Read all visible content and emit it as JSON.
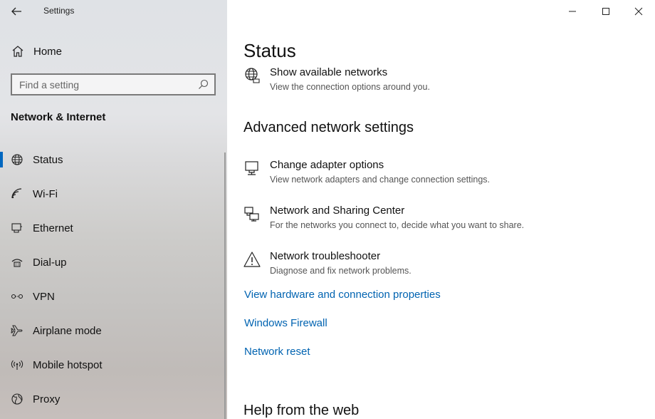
{
  "window": {
    "title": "Settings"
  },
  "sidebar": {
    "home_label": "Home",
    "search_placeholder": "Find a setting",
    "section_title": "Network & Internet",
    "items": [
      {
        "label": "Status",
        "icon": "globe-icon",
        "active": true
      },
      {
        "label": "Wi-Fi",
        "icon": "wifi-icon"
      },
      {
        "label": "Ethernet",
        "icon": "ethernet-icon"
      },
      {
        "label": "Dial-up",
        "icon": "dialup-icon"
      },
      {
        "label": "VPN",
        "icon": "vpn-icon"
      },
      {
        "label": "Airplane mode",
        "icon": "airplane-icon"
      },
      {
        "label": "Mobile hotspot",
        "icon": "hotspot-icon"
      },
      {
        "label": "Proxy",
        "icon": "proxy-icon"
      }
    ]
  },
  "main": {
    "title": "Status",
    "show_networks": {
      "title": "Show available networks",
      "desc": "View the connection options around you."
    },
    "advanced_heading": "Advanced network settings",
    "advanced_items": [
      {
        "title": "Change adapter options",
        "desc": "View network adapters and change connection settings.",
        "icon": "adapter-icon"
      },
      {
        "title": "Network and Sharing Center",
        "desc": "For the networks you connect to, decide what you want to share.",
        "icon": "sharing-center-icon"
      },
      {
        "title": "Network troubleshooter",
        "desc": "Diagnose and fix network problems.",
        "icon": "warning-icon"
      }
    ],
    "links": [
      "View hardware and connection properties",
      "Windows Firewall",
      "Network reset"
    ],
    "help_heading": "Help from the web"
  },
  "colors": {
    "accent": "#0067c0",
    "link": "#0063b1"
  }
}
